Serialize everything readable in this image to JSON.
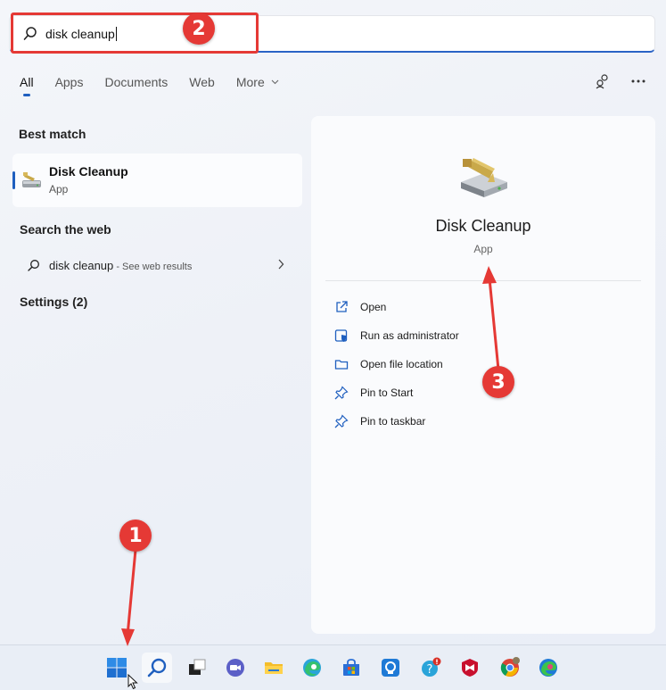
{
  "search": {
    "query": "disk cleanup"
  },
  "tabs": [
    "All",
    "Apps",
    "Documents",
    "Web",
    "More"
  ],
  "sections": {
    "best_match": "Best match",
    "search_web": "Search the web",
    "settings": "Settings (2)"
  },
  "best_match_item": {
    "name": "Disk Cleanup",
    "type": "App"
  },
  "web_result": {
    "query": "disk cleanup",
    "hint": " - See web results"
  },
  "detail": {
    "name": "Disk Cleanup",
    "type": "App",
    "actions": [
      "Open",
      "Run as administrator",
      "Open file location",
      "Pin to Start",
      "Pin to taskbar"
    ]
  },
  "annotations": {
    "badge1": "1",
    "badge2": "2",
    "badge3": "3"
  },
  "colors": {
    "accent": "#1f5fbf",
    "annotation_red": "#e53935"
  },
  "taskbar": [
    "start-icon",
    "search-icon",
    "task-view-icon",
    "chat-icon",
    "file-explorer-icon",
    "edge-icon",
    "store-icon",
    "app-icon",
    "help-icon",
    "mcafee-icon",
    "chrome-icon",
    "edge-dev-icon"
  ]
}
